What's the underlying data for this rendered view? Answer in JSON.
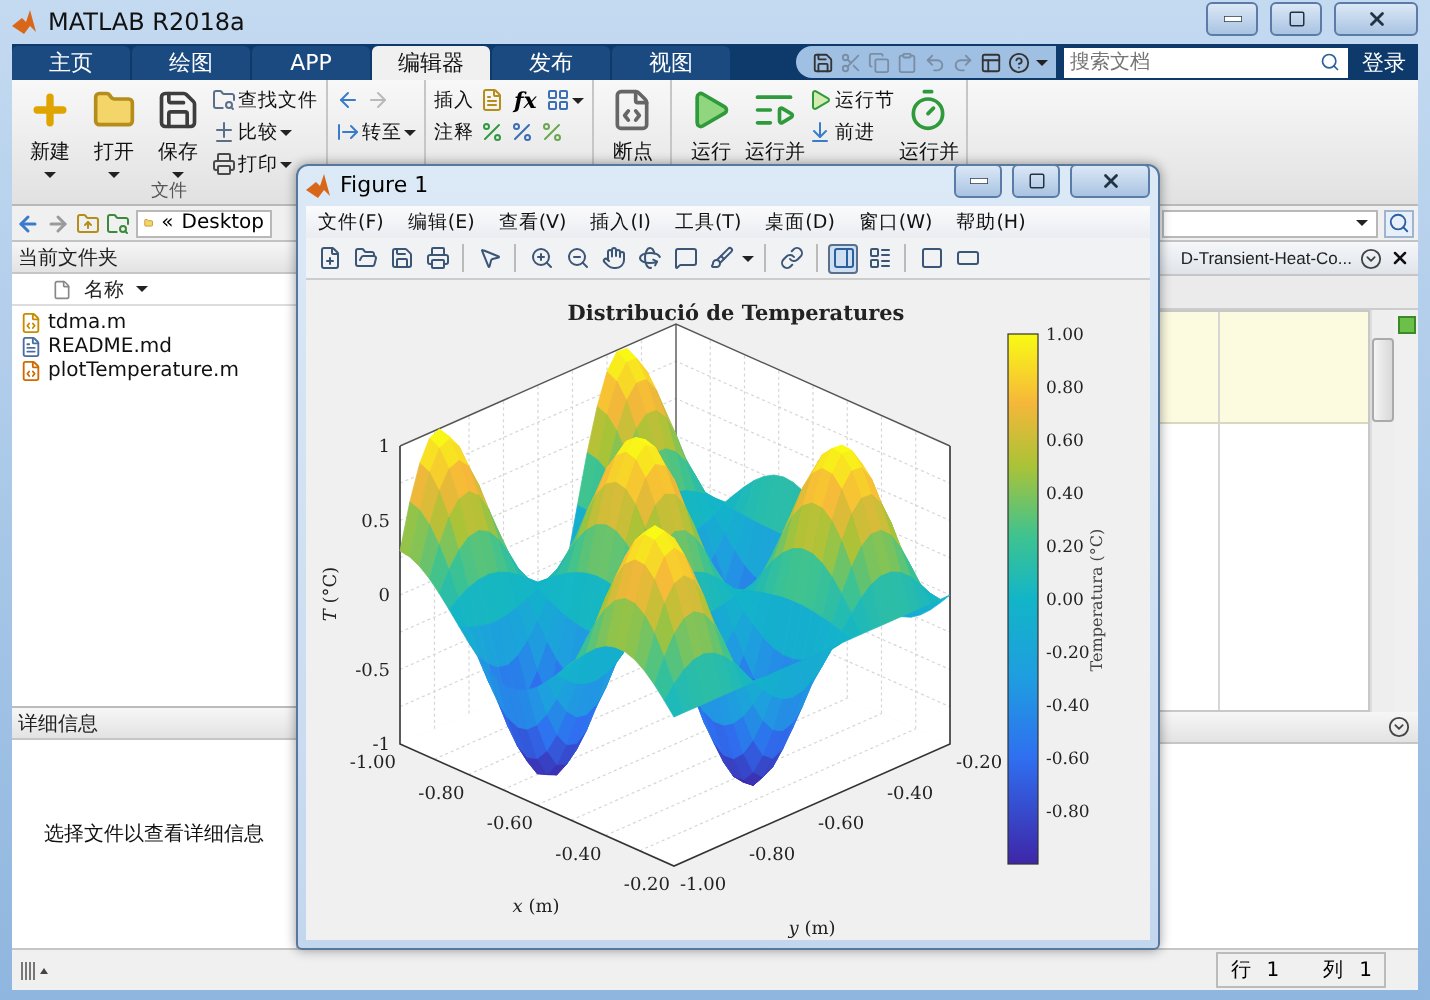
{
  "window": {
    "title": "MATLAB R2018a"
  },
  "tabs": [
    {
      "label": "主页",
      "selected": false
    },
    {
      "label": "绘图",
      "selected": false
    },
    {
      "label": "APP",
      "selected": false
    },
    {
      "label": "编辑器",
      "selected": true
    },
    {
      "label": "发布",
      "selected": false
    },
    {
      "label": "视图",
      "selected": false
    }
  ],
  "quick_access": [
    {
      "kind": "save",
      "disabled": false
    },
    {
      "kind": "cut",
      "disabled": true
    },
    {
      "kind": "copy",
      "disabled": true
    },
    {
      "kind": "paste",
      "disabled": true
    },
    {
      "kind": "undo",
      "disabled": true
    },
    {
      "kind": "redo",
      "disabled": true
    },
    {
      "kind": "layout",
      "disabled": false
    },
    {
      "kind": "help",
      "disabled": false
    }
  ],
  "search": {
    "placeholder": "搜索文档"
  },
  "login": "登录",
  "ribbon": [
    {
      "label": "文件",
      "columns": [
        {
          "large": {
            "kind": "new",
            "label": "新建",
            "menu": true
          }
        },
        {
          "large": {
            "kind": "open",
            "label": "打开",
            "menu": true
          }
        },
        {
          "large": {
            "kind": "save",
            "label": "保存",
            "menu": true
          }
        },
        {
          "rows": [
            [
              {
                "kind": "find",
                "label": "查找文件"
              }
            ],
            [
              {
                "kind": "compare",
                "label": "比较",
                "menu": true
              }
            ],
            [
              {
                "kind": "print",
                "label": "打印",
                "menu": true
              }
            ]
          ]
        }
      ]
    },
    {
      "columns": [
        {
          "rows": [
            [
              {
                "kind": "back"
              },
              {
                "kind": "forward"
              }
            ],
            [
              {
                "kind": "goto",
                "label": "转至",
                "menu": true
              }
            ]
          ]
        }
      ]
    },
    {
      "columns": [
        {
          "rows": [
            [
              {
                "kind": "label",
                "label": "插入"
              },
              {
                "kind": "section"
              },
              {
                "kind": "formula",
                "label": "fx"
              },
              {
                "kind": "chart",
                "menu": true
              }
            ],
            [
              {
                "kind": "label",
                "label": "注释"
              },
              {
                "kind": "comment"
              },
              {
                "kind": "uncomment"
              },
              {
                "kind": "wrap"
              }
            ]
          ]
        }
      ]
    },
    {
      "columns": [
        {
          "large": {
            "kind": "breakpoint",
            "label": "断点"
          }
        }
      ]
    },
    {
      "columns": [
        {
          "large": {
            "kind": "run",
            "label": "运行"
          }
        },
        {
          "large": {
            "kind": "run-advance",
            "label": "运行并"
          }
        },
        {
          "rows": [
            [
              {
                "kind": "run-section",
                "label": "运行节"
              }
            ],
            [
              {
                "kind": "advance",
                "label": "前进"
              }
            ]
          ]
        },
        {
          "large": {
            "kind": "run-time",
            "label": "运行并"
          }
        }
      ]
    }
  ],
  "address_bar": {
    "prefix": "«",
    "folder": "Desktop"
  },
  "file_browser": {
    "title": "当前文件夹",
    "column": "名称",
    "files": [
      {
        "name": "tdma.m",
        "kind": "script"
      },
      {
        "name": "README.md",
        "kind": "text"
      },
      {
        "name": "plotTemperature.m",
        "kind": "function"
      }
    ]
  },
  "details": {
    "title": "详细信息",
    "message": "选择文件以查看详细信息"
  },
  "editor": {
    "tab": "D-Transient-Heat-Co..."
  },
  "status_bar": {
    "line_label": "行",
    "line": "1",
    "column_label": "列",
    "column": "1"
  },
  "figure": {
    "title": "Figure 1",
    "menu": [
      "文件(F)",
      "编辑(E)",
      "查看(V)",
      "插入(I)",
      "工具(T)",
      "桌面(D)",
      "窗口(W)",
      "帮助(H)"
    ],
    "colorbar_pressed": true,
    "plot": {
      "title": "Distribució de Temperatures",
      "z_ticks": [
        "1",
        "0.5",
        "0",
        "-0.5",
        "-1"
      ],
      "x_ticks": [
        "-1.00",
        "-0.80",
        "-0.60",
        "-0.40",
        "-0.20"
      ],
      "y_ticks": [
        "-1.00",
        "-0.80",
        "-0.60",
        "-0.40",
        "-0.20"
      ],
      "x_label": {
        "symbol": "x",
        "unit": "(m)"
      },
      "y_label": {
        "symbol": "y",
        "unit": "(m)"
      },
      "z_label": {
        "symbol": "T",
        "unit": "(°C)"
      },
      "colorbar": {
        "label": "Temperatura (°C)",
        "ticks": [
          "1.00",
          "0.80",
          "0.60",
          "0.40",
          "0.20",
          "0.00",
          "-0.20",
          "-0.40",
          "-0.60",
          "-0.80"
        ]
      }
    }
  }
}
